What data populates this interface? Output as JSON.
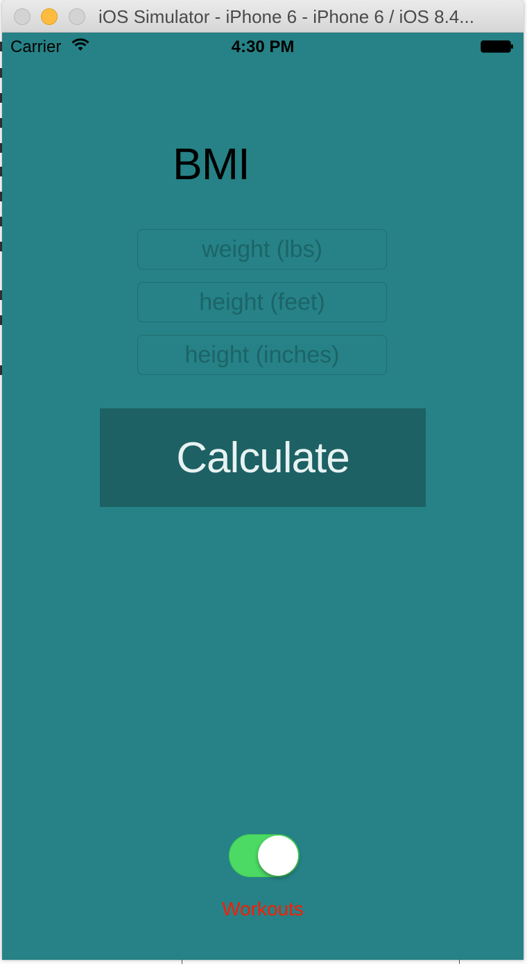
{
  "window": {
    "title": "iOS Simulator - iPhone 6 - iPhone 6 / iOS 8.4..."
  },
  "status_bar": {
    "carrier": "Carrier",
    "time": "4:30 PM",
    "icons": [
      "wifi-icon",
      "battery-icon"
    ]
  },
  "app": {
    "title": "BMI",
    "fields": {
      "weight_placeholder": "weight (lbs)",
      "feet_placeholder": "height (feet)",
      "inches_placeholder": "height (inches)",
      "weight_value": "",
      "feet_value": "",
      "inches_value": ""
    },
    "calculate_label": "Calculate",
    "toggle": {
      "on": true
    },
    "toggle_label": "Workouts"
  },
  "colors": {
    "screen_background": "#268286",
    "button_background": "#1d6164",
    "toggle_on": "#4cd964",
    "workouts_label": "#ff1a00"
  }
}
